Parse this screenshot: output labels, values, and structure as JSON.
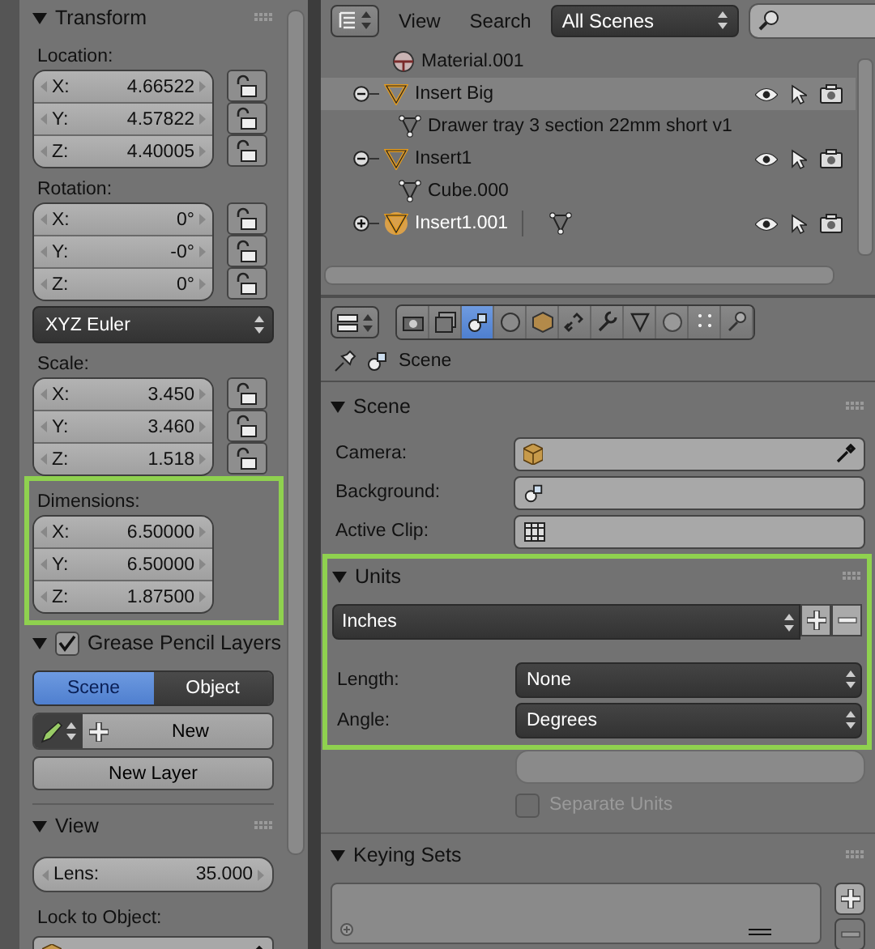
{
  "transform": {
    "title": "Transform",
    "expanded": true,
    "blocks": [
      {
        "kind": "vector",
        "label": "Location:",
        "fields": [
          {
            "axis": "X:",
            "value": "4.66522",
            "locked": false
          },
          {
            "axis": "Y:",
            "value": "4.57822",
            "locked": false
          },
          {
            "axis": "Z:",
            "value": "4.40005",
            "locked": false
          }
        ]
      },
      {
        "kind": "vector",
        "label": "Rotation:",
        "fields": [
          {
            "axis": "X:",
            "value": "0°",
            "locked": false
          },
          {
            "axis": "Y:",
            "value": "-0°",
            "locked": false
          },
          {
            "axis": "Z:",
            "value": "0°",
            "locked": false
          }
        ]
      },
      {
        "kind": "menu",
        "value": "XYZ Euler"
      },
      {
        "kind": "vector",
        "label": "Scale:",
        "fields": [
          {
            "axis": "X:",
            "value": "3.450",
            "locked": false
          },
          {
            "axis": "Y:",
            "value": "3.460",
            "locked": false
          },
          {
            "axis": "Z:",
            "value": "1.518",
            "locked": false
          }
        ]
      },
      {
        "kind": "vector",
        "label": "Dimensions:",
        "highlighted": true,
        "fields": [
          {
            "axis": "X:",
            "value": "6.50000"
          },
          {
            "axis": "Y:",
            "value": "6.50000"
          },
          {
            "axis": "Z:",
            "value": "1.87500"
          }
        ]
      }
    ]
  },
  "grease_pencil": {
    "title": "Grease Pencil Layers",
    "expanded": true,
    "enabled": true,
    "tabs": [
      {
        "label": "Scene",
        "selected": true
      },
      {
        "label": "Object",
        "selected": false
      }
    ],
    "new_button": "New",
    "new_layer_button": "New Layer"
  },
  "view": {
    "title": "View",
    "expanded": true,
    "lens": {
      "label": "Lens:",
      "value": "35.000"
    },
    "lock_label": "Lock to Object:"
  },
  "outliner": {
    "menus": [
      "View",
      "Search"
    ],
    "scene_filter": "All Scenes",
    "rows": [
      {
        "kind": "material",
        "name": "Material.001"
      },
      {
        "kind": "object",
        "name": "Insert Big",
        "expanded": true,
        "selected": true,
        "active": false,
        "children": [
          {
            "kind": "mesh",
            "name": "Drawer tray 3 section 22mm short v1"
          }
        ]
      },
      {
        "kind": "object",
        "name": "Insert1",
        "expanded": true,
        "selected": false,
        "active": false,
        "children": [
          {
            "kind": "mesh",
            "name": "Cube.000"
          }
        ]
      },
      {
        "kind": "object",
        "name": "Insert1.001",
        "expanded": false,
        "selected": false,
        "active": true,
        "children": [
          {
            "kind": "mesh"
          }
        ]
      }
    ]
  },
  "properties": {
    "tabs": [
      {
        "selected": false
      },
      {
        "selected": false
      },
      {
        "selected": true
      },
      {
        "selected": false
      },
      {
        "selected": false
      },
      {
        "selected": false
      },
      {
        "selected": false
      },
      {
        "selected": false
      },
      {
        "selected": false
      },
      {
        "selected": false
      },
      {
        "selected": false
      }
    ],
    "context": "Scene",
    "scene_panel": {
      "title": "Scene",
      "expanded": true,
      "fields": [
        {
          "label": "Camera:",
          "kind": "object"
        },
        {
          "label": "Background:",
          "kind": "scene"
        },
        {
          "label": "Active Clip:",
          "kind": "clip"
        }
      ]
    },
    "units_panel": {
      "title": "Units",
      "expanded": true,
      "highlighted": true,
      "preset": "Inches",
      "rows": [
        {
          "label": "Length:",
          "value": "None"
        },
        {
          "label": "Angle:",
          "value": "Degrees"
        }
      ],
      "separate_units": {
        "label": "Separate Units",
        "checked": false,
        "disabled": true
      }
    },
    "keying_panel": {
      "title": "Keying Sets",
      "expanded": true
    }
  }
}
